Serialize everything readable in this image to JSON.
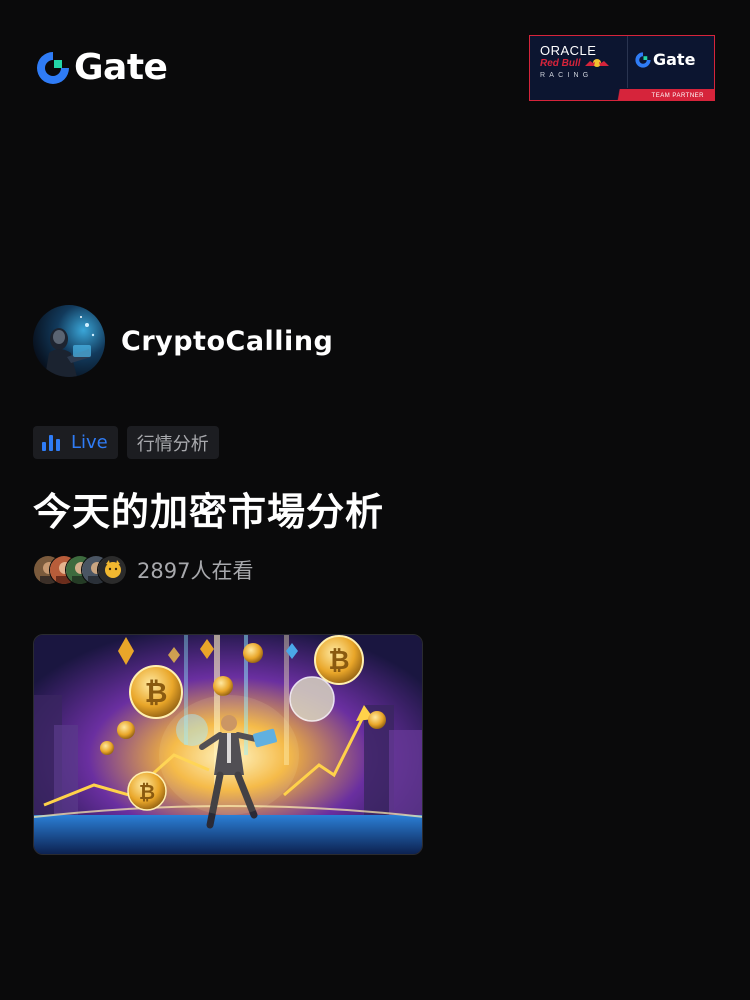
{
  "header": {
    "brand_name": "Gate",
    "partner": {
      "oracle": "ORACLE",
      "redbull": "Red Bull",
      "racing": "RACING",
      "gate": "Gate",
      "strip": "TEAM PARTNER"
    }
  },
  "host": {
    "name": "CryptoCalling"
  },
  "tags": {
    "live_label": "Live",
    "category": "行情分析"
  },
  "stream": {
    "title": "今天的加密市場分析",
    "viewers_text": "2897人在看"
  },
  "colors": {
    "background": "#0a0a0b",
    "accent_blue": "#2f7cf6",
    "partner_red": "#d6243b",
    "partner_navy": "#0c1530"
  },
  "icons": {
    "brand": "gate-logo-icon",
    "live": "live-bars-icon"
  }
}
